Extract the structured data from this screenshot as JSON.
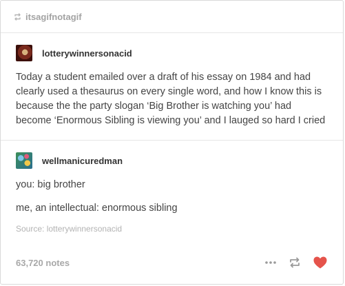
{
  "reblog": {
    "name": "itsagifnotagif",
    "icon": "reblog-small-icon"
  },
  "posts": [
    {
      "username": "lotterywinnersonacid",
      "text": "Today a student emailed over a draft of his essay on 1984 and had clearly used a thesaurus on every single word, and how I know this is because the the party slogan ‘Big Brother is watching you’ had become ‘Enormous Sibling is viewing you’ and I lauged so hard I cried"
    },
    {
      "username": "wellmanicuredman",
      "lines": [
        "you: big brother",
        "me, an intellectual: enormous sibling"
      ]
    }
  ],
  "source": "Source: lotterywinnersonacid",
  "footer": {
    "notes": "63,720 notes",
    "more_icon": "ellipsis-icon",
    "reblog_icon": "reblog-icon",
    "like_icon": "heart-icon"
  },
  "colors": {
    "heart": "#e5534b",
    "muted": "#a8a8a8"
  }
}
